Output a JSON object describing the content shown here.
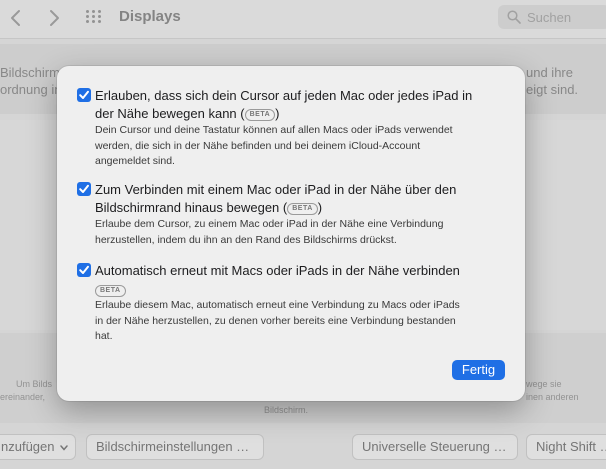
{
  "toolbar": {
    "back_icon": "chevron-left-icon",
    "forward_icon": "chevron-right-icon",
    "grid_icon": "grid-icon",
    "title": "Displays",
    "search_placeholder": "Suchen"
  },
  "background": {
    "upper_left_line1": "Bildschirm",
    "upper_left_line2": "ordnung in",
    "upper_right_line1": "und ihre",
    "upper_right_line2": "eigt sind.",
    "lower_left_line1": "Um Bilds",
    "lower_left_line2": "ereinander,",
    "lower_right_line1": "wege sie",
    "lower_right_line2": "inen anderen",
    "lower_center": "Bildschirm.",
    "buttons": [
      "nzufügen",
      "Bildschirmeinstellungen …",
      "Universelle Steuerung …",
      "Night Shift …"
    ]
  },
  "dialog": {
    "options": [
      {
        "checked": true,
        "title_line1": "Erlauben, dass sich dein Cursor auf jeden Mac oder jedes iPad in",
        "title_line2": "der Nähe bewegen kann (",
        "badge": "BETA",
        "title_end": ")",
        "description_lines": [
          "Dein Cursor und deine Tastatur können auf allen Macs oder iPads verwendet",
          "werden, die sich in der Nähe befinden und bei deinem iCloud-Account",
          "angemeldet sind."
        ]
      },
      {
        "checked": true,
        "title_line1": "Zum Verbinden mit einem Mac oder iPad in der Nähe über den",
        "title_line2": "Bildschirmrand hinaus bewegen (",
        "badge": "BETA",
        "title_end": ")",
        "description_lines": [
          "Erlaube dem Cursor, zu einem Mac oder iPad in der Nähe eine Verbindung",
          "herzustellen, indem du ihn an den Rand des Bildschirms drückst."
        ]
      },
      {
        "checked": true,
        "title_line1": "Automatisch erneut mit Macs oder iPads in der Nähe verbinden",
        "title_line2": "",
        "badge": "BETA",
        "title_end": "",
        "description_lines": [
          "Erlaube diesem Mac, automatisch erneut eine Verbindung zu Macs oder iPads",
          "in der Nähe herzustellen, zu denen vorher bereits eine Verbindung bestanden",
          "hat."
        ]
      }
    ],
    "done_label": "Fertig"
  },
  "colors": {
    "accent": "#1f6fe5",
    "dialog_bg": "#efefef",
    "backdrop": "#dcdcdc"
  }
}
